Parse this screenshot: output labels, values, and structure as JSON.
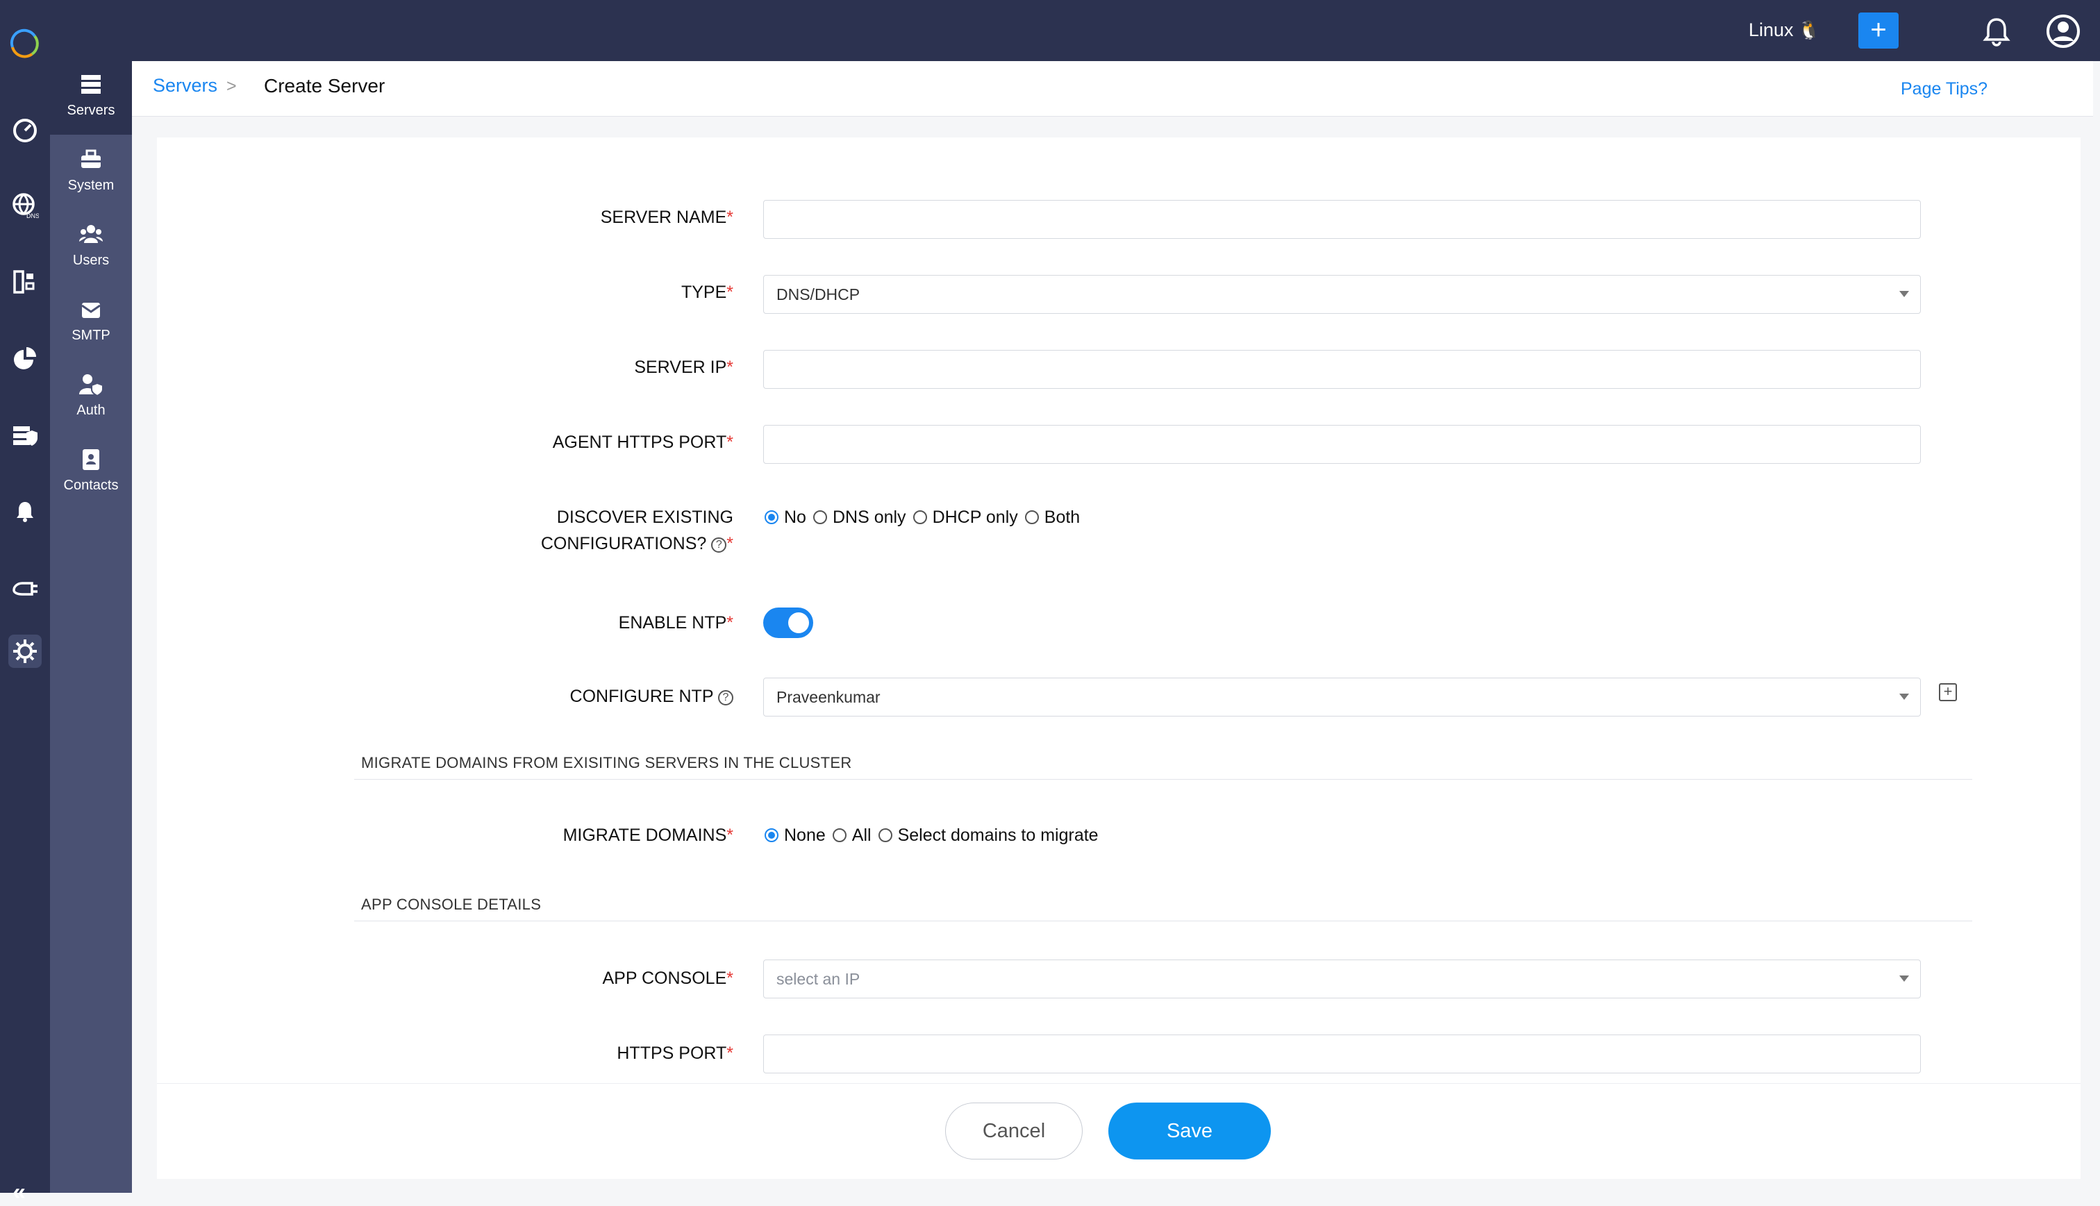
{
  "topbar": {
    "os_label": "Linux",
    "os_icon": "penguin-icon",
    "add_label": "+",
    "accent": "#1a86f0",
    "bg": "#2c3250"
  },
  "rail": {
    "icons": [
      "dashboard-icon",
      "dns-globe-icon",
      "ipam-icon",
      "reports-pie-icon",
      "server-shield-icon",
      "alerts-bell-icon",
      "plugin-icon",
      "admin-gear-icon"
    ],
    "collapse_label": "«"
  },
  "subnav": {
    "items": [
      {
        "label": "Servers",
        "icon": "servers-icon"
      },
      {
        "label": "System",
        "icon": "toolbox-icon"
      },
      {
        "label": "Users",
        "icon": "users-icon"
      },
      {
        "label": "SMTP",
        "icon": "mail-icon"
      },
      {
        "label": "Auth",
        "icon": "user-shield-icon"
      },
      {
        "label": "Contacts",
        "icon": "contact-book-icon"
      }
    ]
  },
  "header": {
    "breadcrumb_link": "Servers",
    "breadcrumb_sep": ">",
    "breadcrumb_current": "Create Server",
    "page_tips": "Page Tips?"
  },
  "form": {
    "server_name": {
      "label": "SERVER NAME",
      "req": "*",
      "value": ""
    },
    "type": {
      "label": "TYPE",
      "req": "*",
      "value": "DNS/DHCP"
    },
    "server_ip": {
      "label": "SERVER IP",
      "req": "*",
      "value": ""
    },
    "agent_port": {
      "label": "AGENT HTTPS PORT",
      "req": "*",
      "value": ""
    },
    "discover": {
      "label_line1": "DISCOVER EXISTING",
      "label_line2": "CONFIGURATIONS?",
      "help": "?",
      "req": "*",
      "options": [
        "No",
        "DNS only",
        "DHCP only",
        "Both"
      ],
      "selected": "No"
    },
    "enable_ntp": {
      "label": "ENABLE NTP",
      "req": "*",
      "on": true
    },
    "configure_ntp": {
      "label": "CONFIGURE NTP",
      "help": "?",
      "value": "Praveenkumar",
      "add": "+"
    },
    "migrate_section": "MIGRATE DOMAINS FROM EXISITING SERVERS IN THE CLUSTER",
    "migrate_domains": {
      "label": "MIGRATE DOMAINS",
      "req": "*",
      "options": [
        "None",
        "All",
        "Select domains to migrate"
      ],
      "selected": "None"
    },
    "app_section": "APP CONSOLE DETAILS",
    "app_console": {
      "label": "APP CONSOLE",
      "req": "*",
      "placeholder": "select an IP"
    },
    "https_port": {
      "label": "HTTPS PORT",
      "req": "*",
      "value": ""
    }
  },
  "footer": {
    "cancel": "Cancel",
    "save": "Save"
  }
}
